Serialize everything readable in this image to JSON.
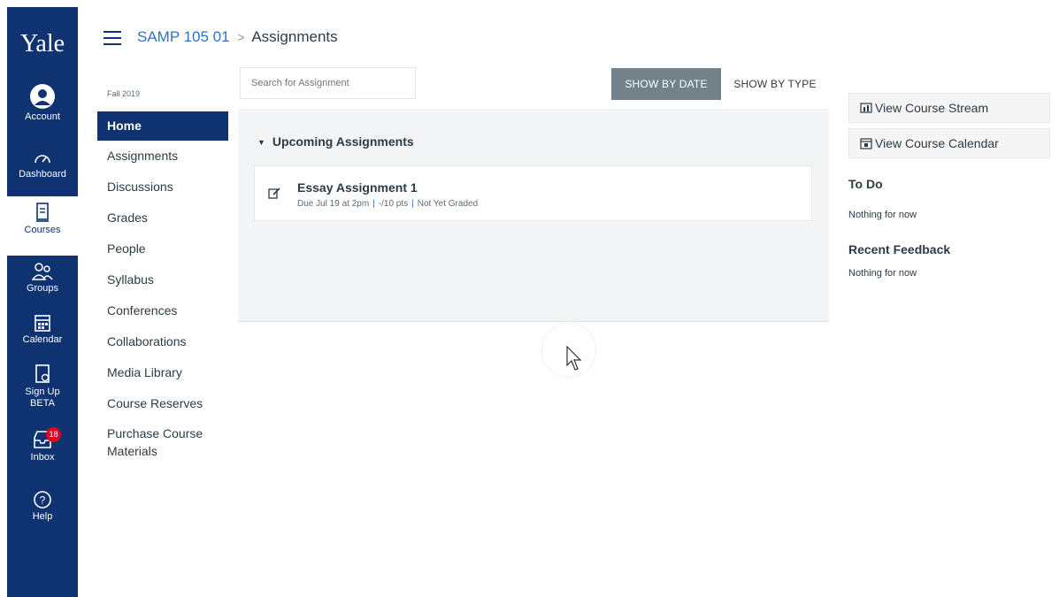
{
  "global_nav": {
    "logo": "Yale",
    "items": [
      {
        "label": "Account",
        "icon": "account-icon"
      },
      {
        "label": "Dashboard",
        "icon": "dashboard-icon"
      },
      {
        "label": "Courses",
        "icon": "courses-icon",
        "active": true
      },
      {
        "label": "Groups",
        "icon": "groups-icon"
      },
      {
        "label": "Calendar",
        "icon": "calendar-icon"
      },
      {
        "label": "Sign Up",
        "label2": "BETA",
        "icon": "signup-icon"
      },
      {
        "label": "Inbox",
        "icon": "inbox-icon",
        "badge": "18"
      },
      {
        "label": "Help",
        "icon": "help-icon"
      }
    ]
  },
  "header": {
    "breadcrumb_course": "SAMP 105 01",
    "breadcrumb_sep": ">",
    "breadcrumb_current": "Assignments"
  },
  "course_nav": {
    "term": "Fall 2019",
    "items": [
      "Home",
      "Assignments",
      "Discussions",
      "Grades",
      "People",
      "Syllabus",
      "Conferences",
      "Collaborations",
      "Media Library",
      "Course Reserves",
      "Purchase Course Materials"
    ]
  },
  "toolbar": {
    "search_placeholder": "Search for Assignment",
    "show_by_date": "SHOW BY DATE",
    "show_by_type": "SHOW BY TYPE"
  },
  "assignments": {
    "group_title": "Upcoming Assignments",
    "items": [
      {
        "title": "Essay Assignment 1",
        "due": "Due Jul 19 at 2pm",
        "points": "-/10 pts",
        "status": "Not Yet Graded"
      }
    ]
  },
  "sidebar": {
    "view_stream": "View Course Stream",
    "view_calendar": "View Course Calendar",
    "todo_title": "To Do",
    "todo_text": "Nothing for now",
    "feedback_title": "Recent Feedback",
    "feedback_text": "Nothing for now"
  },
  "colors": {
    "nav_bg": "#0f3270",
    "link": "#2f72c3",
    "badge": "#e0061f",
    "active_button": "#73818b"
  }
}
